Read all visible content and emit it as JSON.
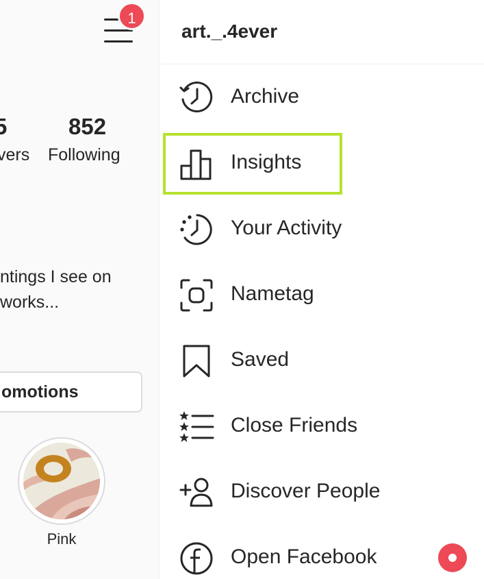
{
  "profile": {
    "notification_count": "1",
    "followers_partial_value": "5",
    "followers_partial_label": "vers",
    "following_count": "852",
    "following_label": "Following",
    "bio_line1": "ntings I see on",
    "bio_line2": "works...",
    "promotions_button": "omotions",
    "highlight_label": "Pink"
  },
  "menu": {
    "username": "art._.4ever",
    "items": [
      {
        "label": "Archive",
        "icon": "archive-icon"
      },
      {
        "label": "Insights",
        "icon": "insights-icon",
        "highlighted": true
      },
      {
        "label": "Your Activity",
        "icon": "activity-icon"
      },
      {
        "label": "Nametag",
        "icon": "nametag-icon"
      },
      {
        "label": "Saved",
        "icon": "saved-icon"
      },
      {
        "label": "Close Friends",
        "icon": "close-friends-icon"
      },
      {
        "label": "Discover People",
        "icon": "discover-people-icon"
      },
      {
        "label": "Open Facebook",
        "icon": "facebook-icon",
        "badge": "notification-dot"
      }
    ]
  },
  "colors": {
    "badge_red": "#ed4956",
    "highlight_green": "#b6e22e",
    "text": "#262626"
  }
}
